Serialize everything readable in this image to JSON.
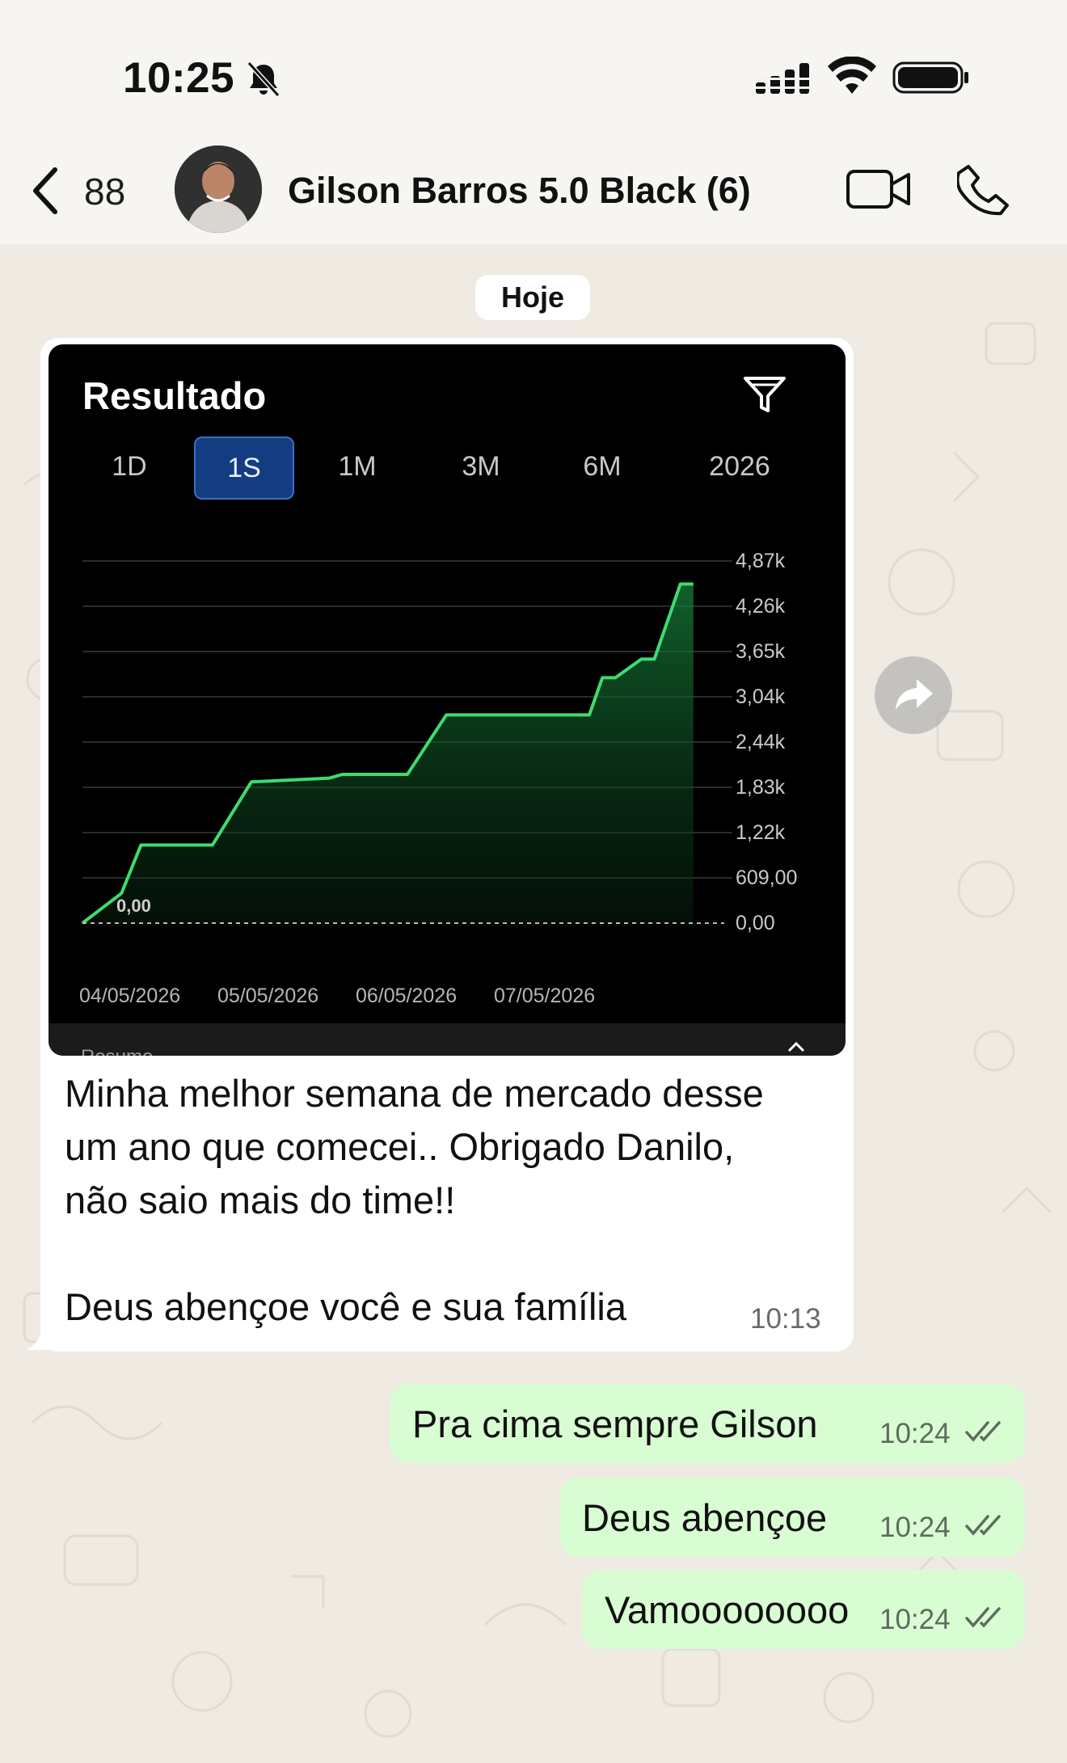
{
  "status_bar": {
    "time": "10:25",
    "icons": [
      "bell-slash-icon",
      "signal-icon",
      "wifi-icon",
      "battery-icon"
    ]
  },
  "header": {
    "back_count": "88",
    "title": "Gilson Barros 5.0 Black (6)",
    "icons": [
      "chevron-left-icon",
      "video-call-icon",
      "phone-call-icon"
    ]
  },
  "date_chip": "Hoje",
  "incoming": {
    "screenshot": {
      "title": "Resultado",
      "tabs": [
        "1D",
        "1S",
        "1M",
        "3M",
        "6M",
        "2026"
      ],
      "active_tab": "1S",
      "baseline_label": "0,00",
      "footer_label": "Resumo",
      "chart_data": {
        "type": "area",
        "x_ticks": [
          "04/05/2026",
          "05/05/2026",
          "06/05/2026",
          "07/05/2026"
        ],
        "y_ticks": [
          "4,87k",
          "4,26k",
          "3,65k",
          "3,04k",
          "2,44k",
          "1,83k",
          "1,22k",
          "609,00",
          "0,00"
        ],
        "ylim": [
          0,
          4870
        ],
        "x": [
          0.0,
          0.3,
          0.45,
          1.0,
          1.3,
          1.9,
          2.0,
          2.5,
          2.8,
          3.9,
          4.0,
          4.1,
          4.3,
          4.4,
          4.6,
          4.7
        ],
        "values": [
          0,
          400,
          1050,
          1050,
          1900,
          1950,
          2000,
          2000,
          2800,
          2800,
          3300,
          3300,
          3550,
          3550,
          4560,
          4560
        ],
        "line_color": "#3ddc6e",
        "fill_color": "#0f5a28",
        "grid": true
      }
    },
    "text_lines": [
      "Minha melhor semana de mercado desse",
      "um ano que comecei.. Obrigado Danilo,",
      "não saio mais do time!!",
      "",
      "Deus abençoe você e sua família"
    ],
    "time": "10:13"
  },
  "outgoing": [
    {
      "text": "Pra cima sempre Gilson",
      "time": "10:24"
    },
    {
      "text": "Deus abençoe",
      "time": "10:24"
    },
    {
      "text": "Vamoooooooo",
      "time": "10:24"
    }
  ],
  "colors": {
    "wallpaper": "#efeae2",
    "outgoing_bubble": "#d9fdd3",
    "active_tab": "#143c80",
    "chart_line": "#3ddc6e"
  }
}
